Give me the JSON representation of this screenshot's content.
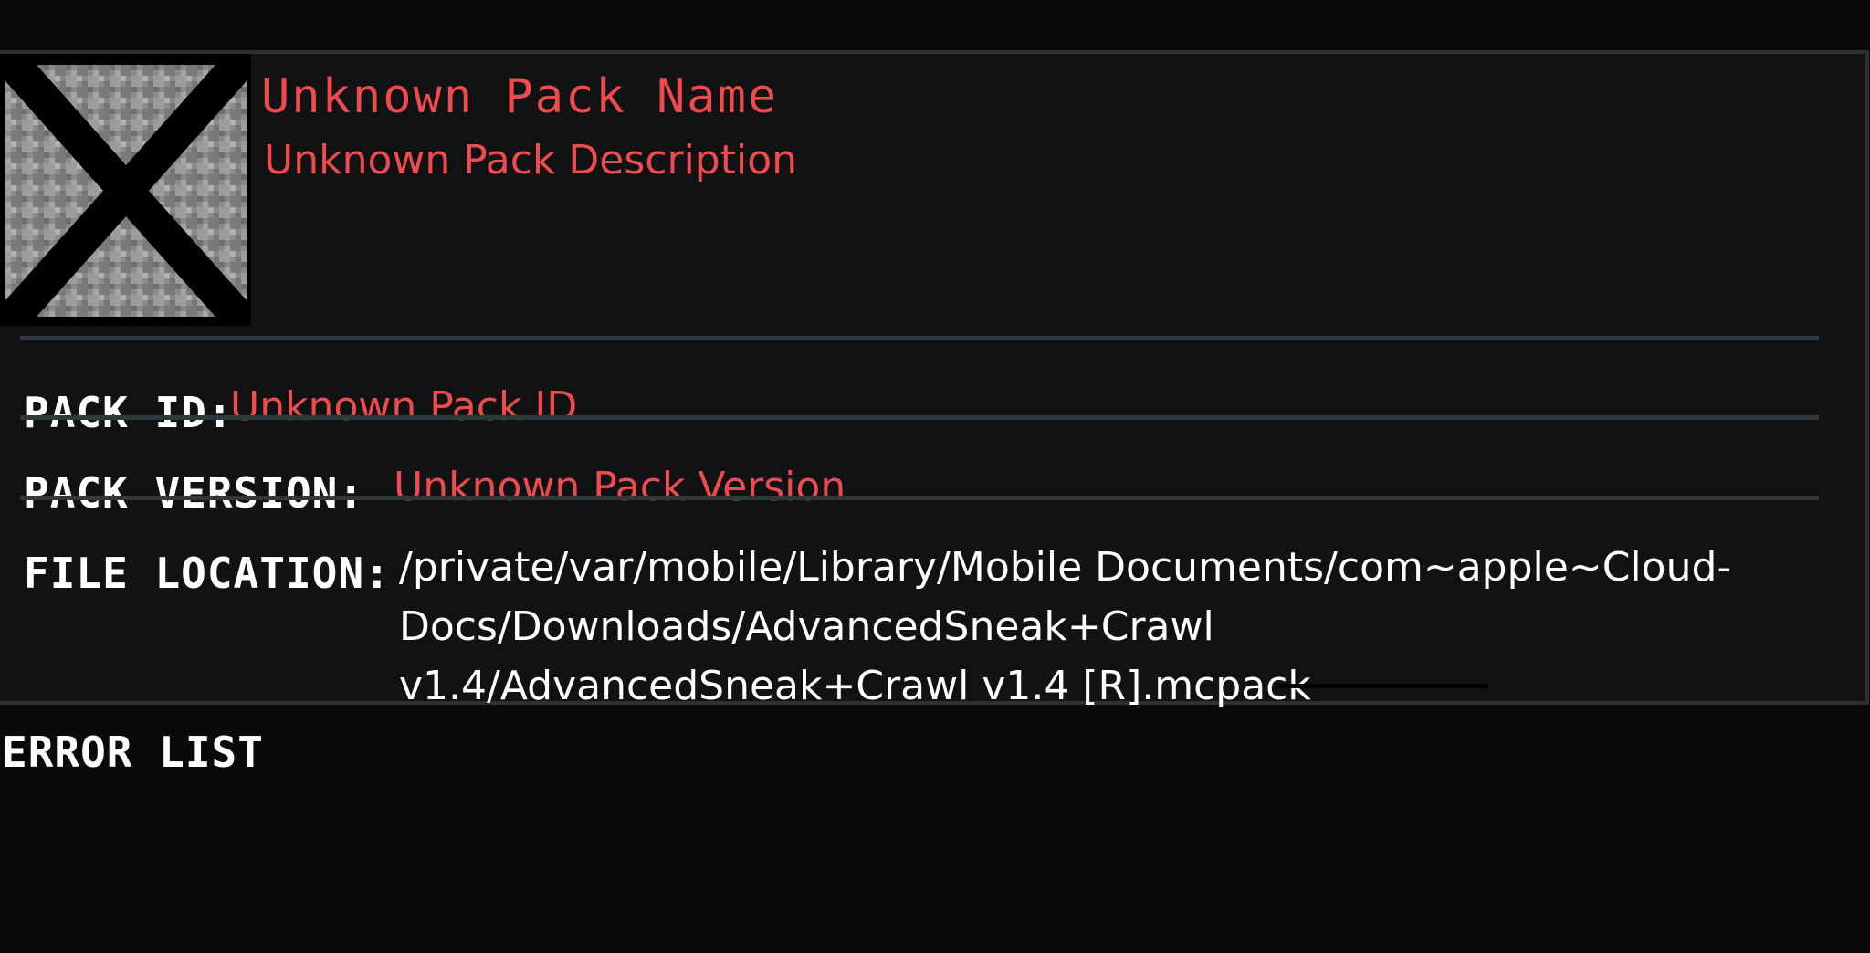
{
  "pack": {
    "name": "Unknown Pack Name",
    "description": "Unknown Pack Description",
    "icon": "missing-texture-icon"
  },
  "details": {
    "pack_id_label": "PACK ID:",
    "pack_id_value": "Unknown Pack ID",
    "pack_version_label": "PACK VERSION:",
    "pack_version_value": "Unknown Pack Version",
    "file_location_label": "FILE LOCATION:",
    "file_location_lines": [
      "/private/var/mobile/Library/Mobile Documents/com~apple~Cloud-",
      "Docs/Downloads/AdvancedSneak+Crawl",
      "v1.4/AdvancedSneak+Crawl v1.4 [R].mcpack"
    ]
  },
  "errors": {
    "title": "ERROR LIST"
  },
  "colors": {
    "background": "#0a0a0a",
    "panel": "#111213",
    "error_text": "#ef4b4e",
    "label_text": "#ffffff",
    "divider": "#2e3a3a"
  }
}
